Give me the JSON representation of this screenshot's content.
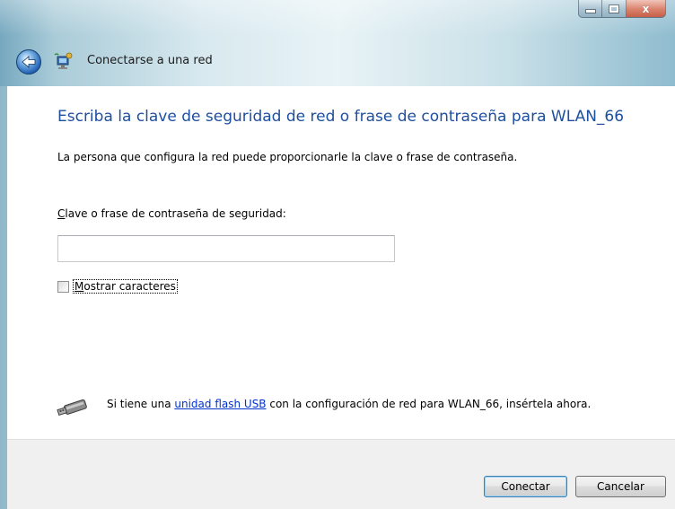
{
  "window": {
    "title": "Conectarse a una red",
    "close_glyph": "x"
  },
  "main": {
    "heading": "Escriba la clave de seguridad de red o frase de contraseña para WLAN_66",
    "description": "La persona que configura la red puede proporcionarle la clave o frase de contraseña.",
    "field_label_accel": "C",
    "field_label_rest": "lave o frase de contraseña de seguridad:",
    "password_value": "",
    "show_chars_accel": "M",
    "show_chars_rest": "ostrar caracteres",
    "usb_prefix": "Si tiene una ",
    "usb_link": "unidad flash USB",
    "usb_suffix": " con la configuración de red para WLAN_66, insértela ahora."
  },
  "footer": {
    "connect_label": "Conectar",
    "cancel_label": "Cancelar"
  },
  "icons": {
    "back": "back-arrow-icon",
    "network": "network-icon",
    "usb": "usb-flash-drive-icon"
  },
  "colors": {
    "heading": "#1e4fa0",
    "link": "#0033cc",
    "footer_bg": "#f0f0f0"
  }
}
